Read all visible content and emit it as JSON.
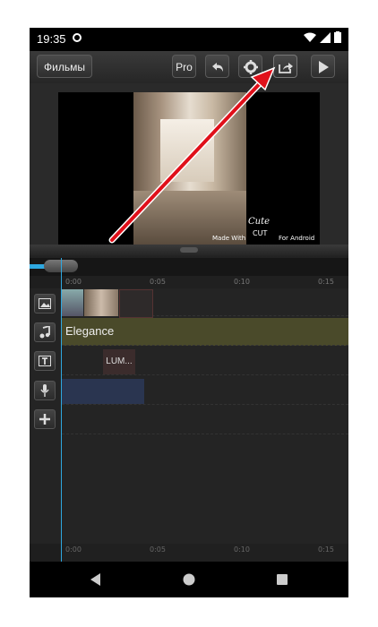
{
  "status": {
    "time": "19:35"
  },
  "toolbar": {
    "films_label": "Фильмы",
    "pro_label": "Pro"
  },
  "preview": {
    "watermark_made_with": "Made With",
    "watermark_cute": "Cute",
    "watermark_cut": "CUT",
    "watermark_android": "For Android"
  },
  "ruler": {
    "ticks": [
      "0:00",
      "0:05",
      "0:10",
      "0:15"
    ]
  },
  "tracks": {
    "audio_clip_label": "Elegance",
    "text_clip_label": "LUM..."
  },
  "colors": {
    "accent": "#2ea8e0",
    "audio_track": "#4a4a2a",
    "arrow": "#e0101a"
  }
}
